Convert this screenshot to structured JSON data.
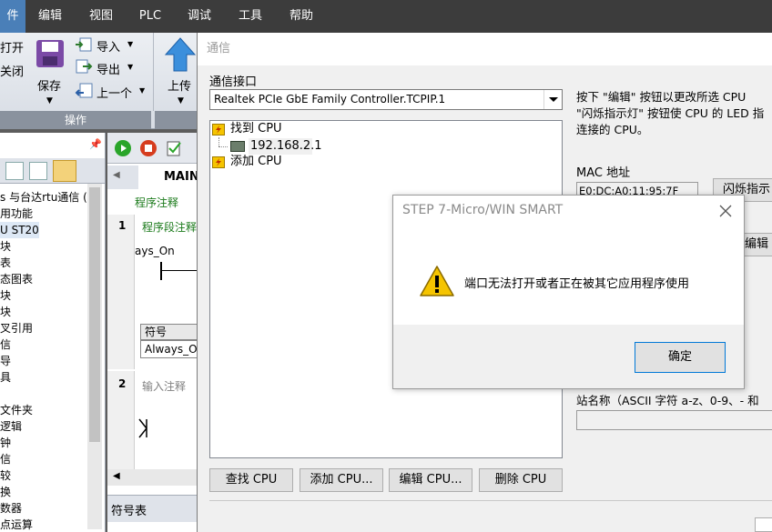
{
  "menubar": {
    "items": [
      "件",
      "编辑",
      "视图",
      "PLC",
      "调试",
      "工具",
      "帮助"
    ]
  },
  "ribbon": {
    "open_label": "打开",
    "close_label": "关闭",
    "save_label": "保存",
    "import_label": "导入",
    "export_label": "导出",
    "previous_label": "上一个",
    "upload_label": "上传",
    "operations_label": "操作"
  },
  "project_tree": {
    "items": [
      "s 与台达rtu通信 (",
      "用功能",
      "U ST20",
      "块",
      "表",
      "态图表",
      "块",
      "块",
      "叉引用",
      "信",
      "导",
      "具",
      "",
      "",
      "文件夹",
      "逻辑",
      "钟",
      "信",
      "较",
      "换",
      "数器",
      "点运算"
    ]
  },
  "editor": {
    "tab_label": "MAIN",
    "program_comment": "程序注释",
    "network1_number": "1",
    "network1_comment": "程序段注释",
    "contact_label": "ays_On",
    "symbol_header": "符号",
    "symbol_value": "Always_O",
    "network2_number": "2",
    "network2_comment": "输入注释",
    "symbol_table_tab": "符号表"
  },
  "comm_dialog": {
    "title": "通信",
    "interface_label": "通信接口",
    "interface_value": "Realtek PCIe GbE Family Controller.TCPIP.1",
    "tree": {
      "found_cpu": "找到 CPU",
      "cpu_ip": "192.168.2.1",
      "add_cpu": "添加 CPU"
    },
    "description": [
      "按下 \"编辑\" 按钮以更改所选 CPU",
      "\"闪烁指示灯\" 按钮使 CPU 的 LED 指",
      "连接的 CPU。"
    ],
    "mac_label": "MAC 地址",
    "mac_value": "E0:DC:A0:11:95:7F",
    "blink_button": "闪烁指示",
    "edit_side_button": "编辑",
    "station_label": "站名称（ASCII 字符 a-z、0-9、- 和",
    "buttons": {
      "find": "查找 CPU",
      "add": "添加 CPU...",
      "edit": "编辑 CPU...",
      "delete": "删除 CPU"
    }
  },
  "message_box": {
    "title": "STEP 7-Micro/WIN SMART",
    "message": "端口无法打开或者正在被其它应用程序使用",
    "ok_label": "确定"
  },
  "colors": {
    "menubar_bg": "#3c3c3c",
    "menubar_active": "#4a7fb8",
    "dialog_bg": "#f0f0f0",
    "comment_green": "#1a7a1a",
    "warning_yellow": "#f5c400"
  }
}
